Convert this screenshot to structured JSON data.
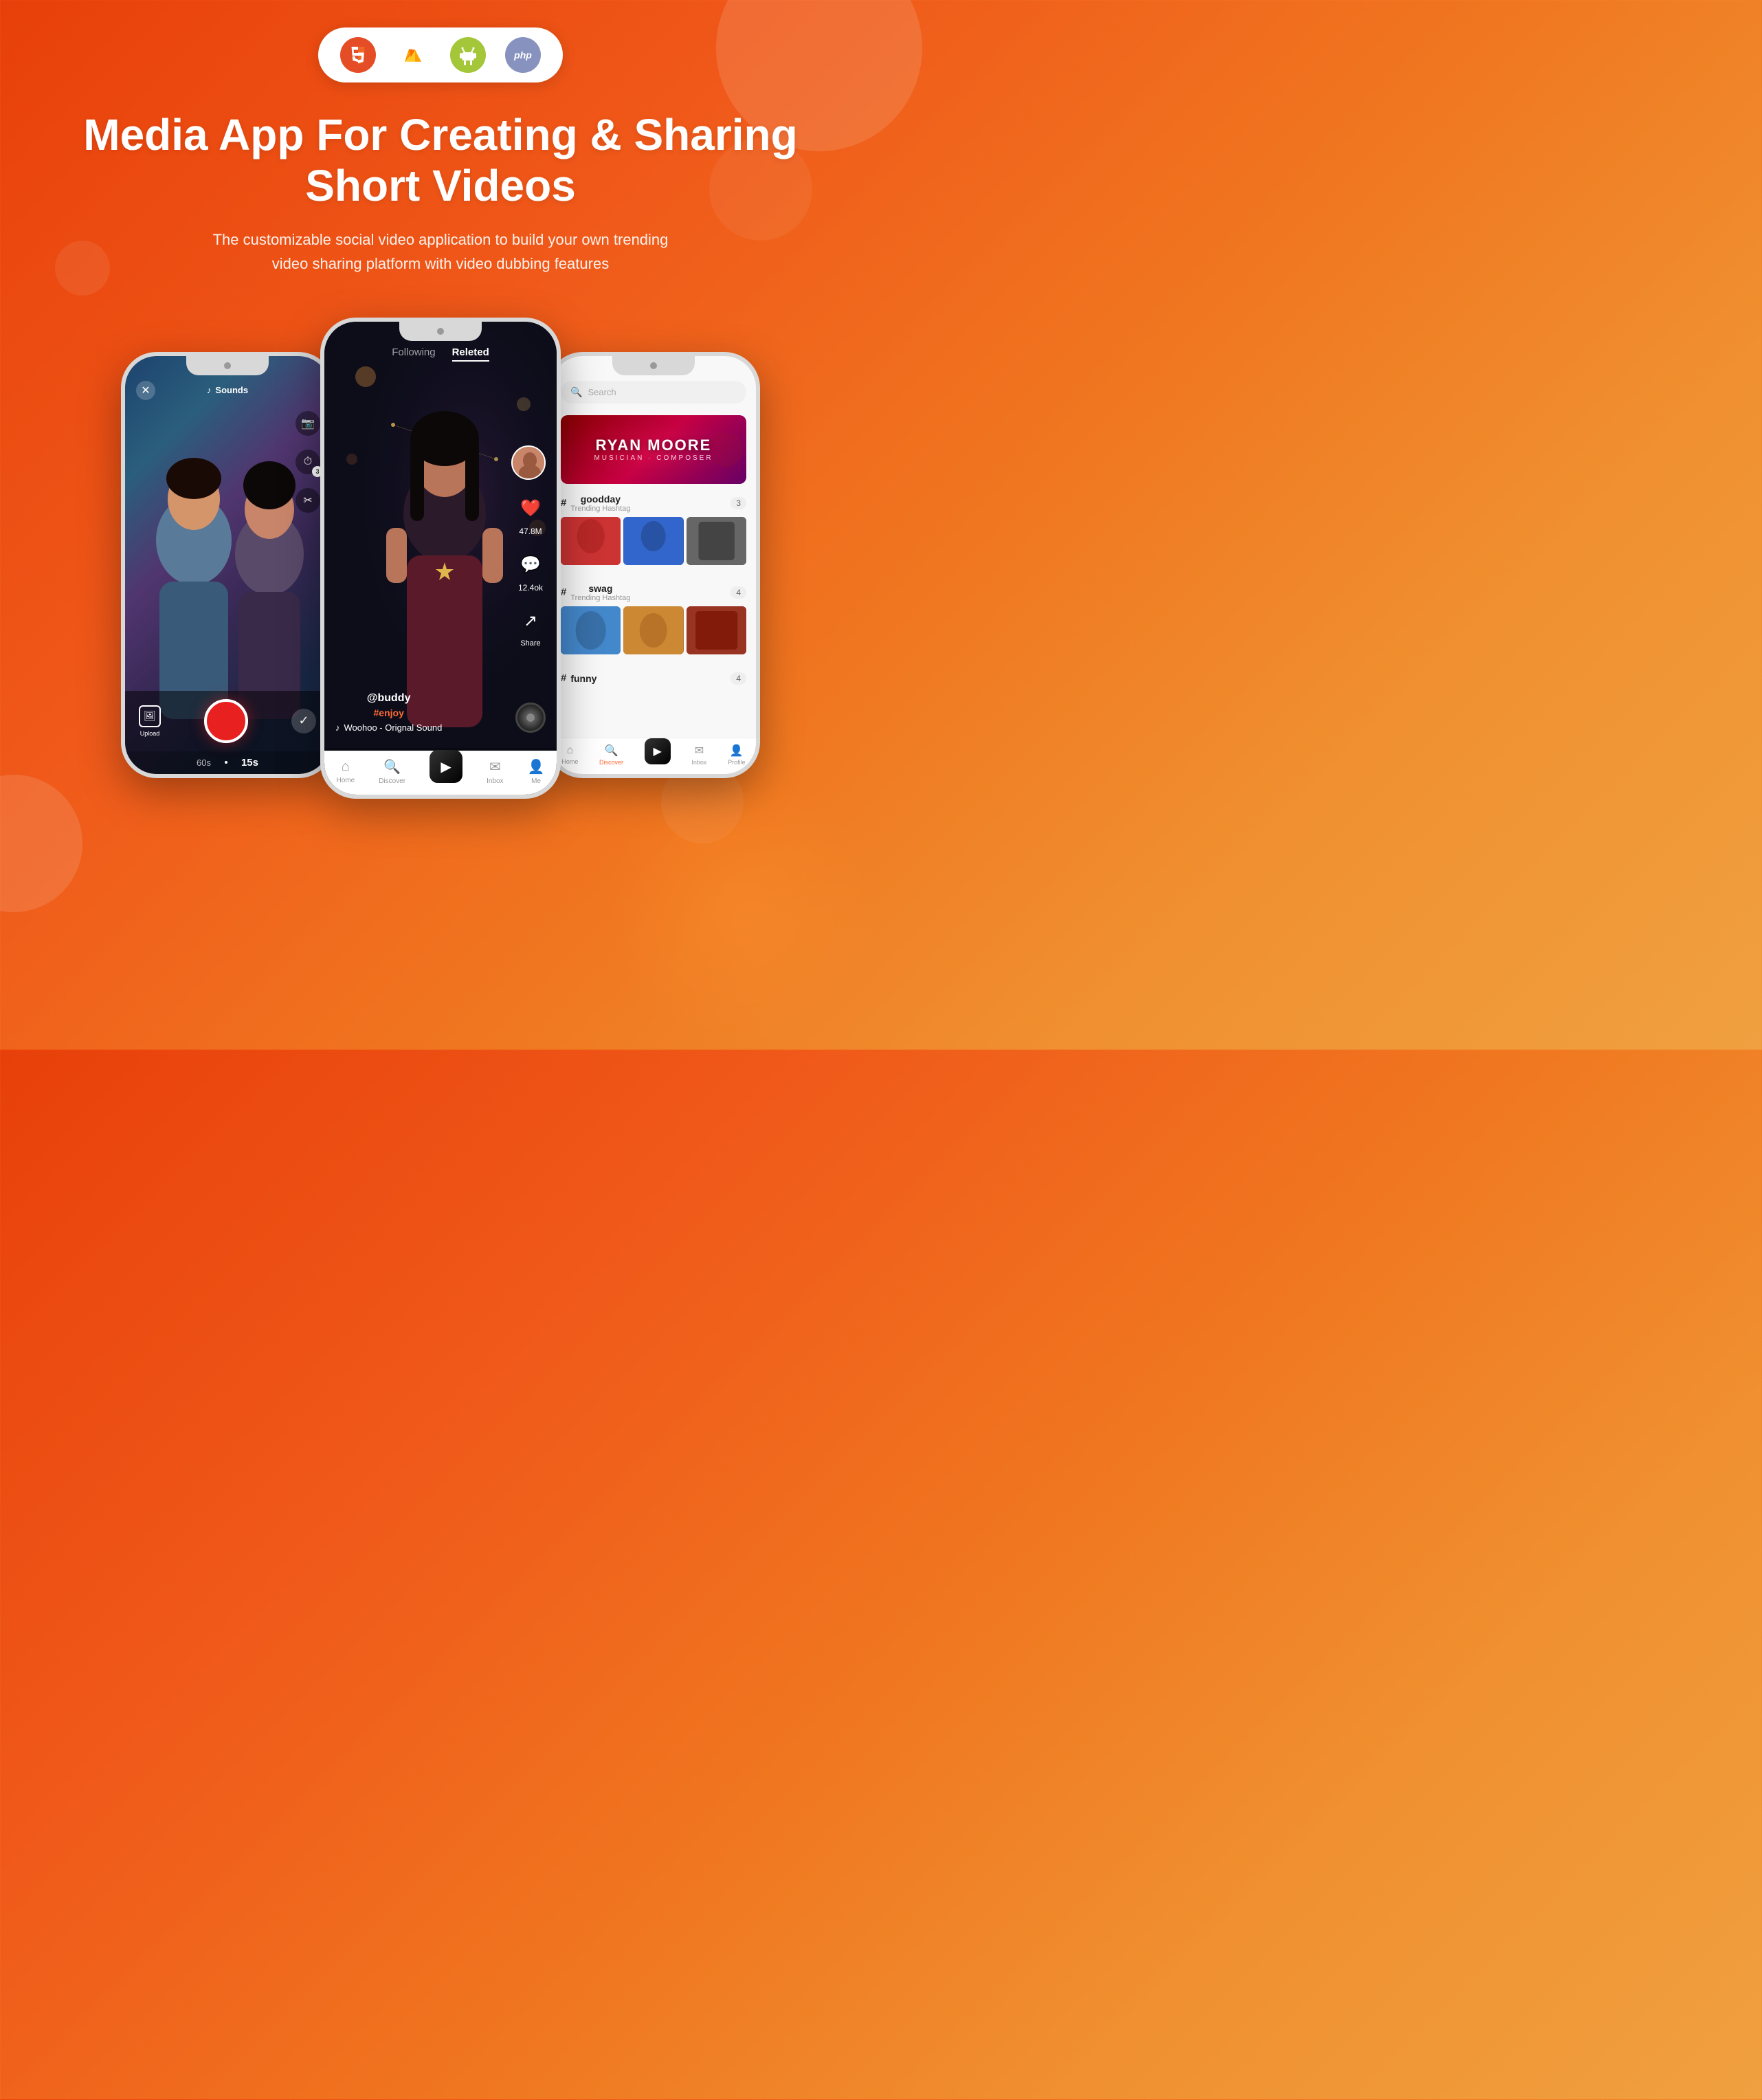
{
  "page": {
    "background_start": "#e8400a",
    "background_end": "#f0a040"
  },
  "tech_badges": {
    "html_label": "HTML5",
    "firebase_label": "Firebase",
    "android_label": "Android",
    "php_label": "php"
  },
  "hero": {
    "title": "Media App For Creating & Sharing Short Videos",
    "subtitle": "The customizable social video application to build your own trending video sharing platform with video dubbing features"
  },
  "phone_left": {
    "screen": "camera",
    "close_icon": "✕",
    "sound_label": "Sounds",
    "camera_icon": "📷",
    "timer_icon": "⏱",
    "effect_icon": "✨",
    "upload_label": "Upload",
    "timer_60": "60s",
    "timer_15": "15s"
  },
  "phone_center": {
    "screen": "video_feed",
    "tab_following": "Following",
    "tab_related": "Releted",
    "username": "@buddy",
    "hashtag": "#enjoy",
    "sound_name": "Woohoo - Orignal Sound",
    "likes": "47.8M",
    "comments": "12.4ok",
    "nav_home": "Home",
    "nav_discover": "Discover",
    "nav_inbox": "Inbox",
    "nav_me": "Me"
  },
  "phone_right": {
    "screen": "discover",
    "search_placeholder": "Search",
    "banner_name": "RYAN MOORE",
    "banner_subtitle": "musician · composer",
    "hashtag1_name": "goodday",
    "hashtag1_type": "Trending Hashtag",
    "hashtag1_count": "3",
    "hashtag2_name": "swag",
    "hashtag2_type": "Trending Hashtag",
    "hashtag2_count": "4",
    "hashtag3_name": "funny",
    "hashtag3_count": "4",
    "nav_home": "Home",
    "nav_discover": "Discover",
    "nav_inbox": "Inbox",
    "nav_profile": "Profile"
  }
}
